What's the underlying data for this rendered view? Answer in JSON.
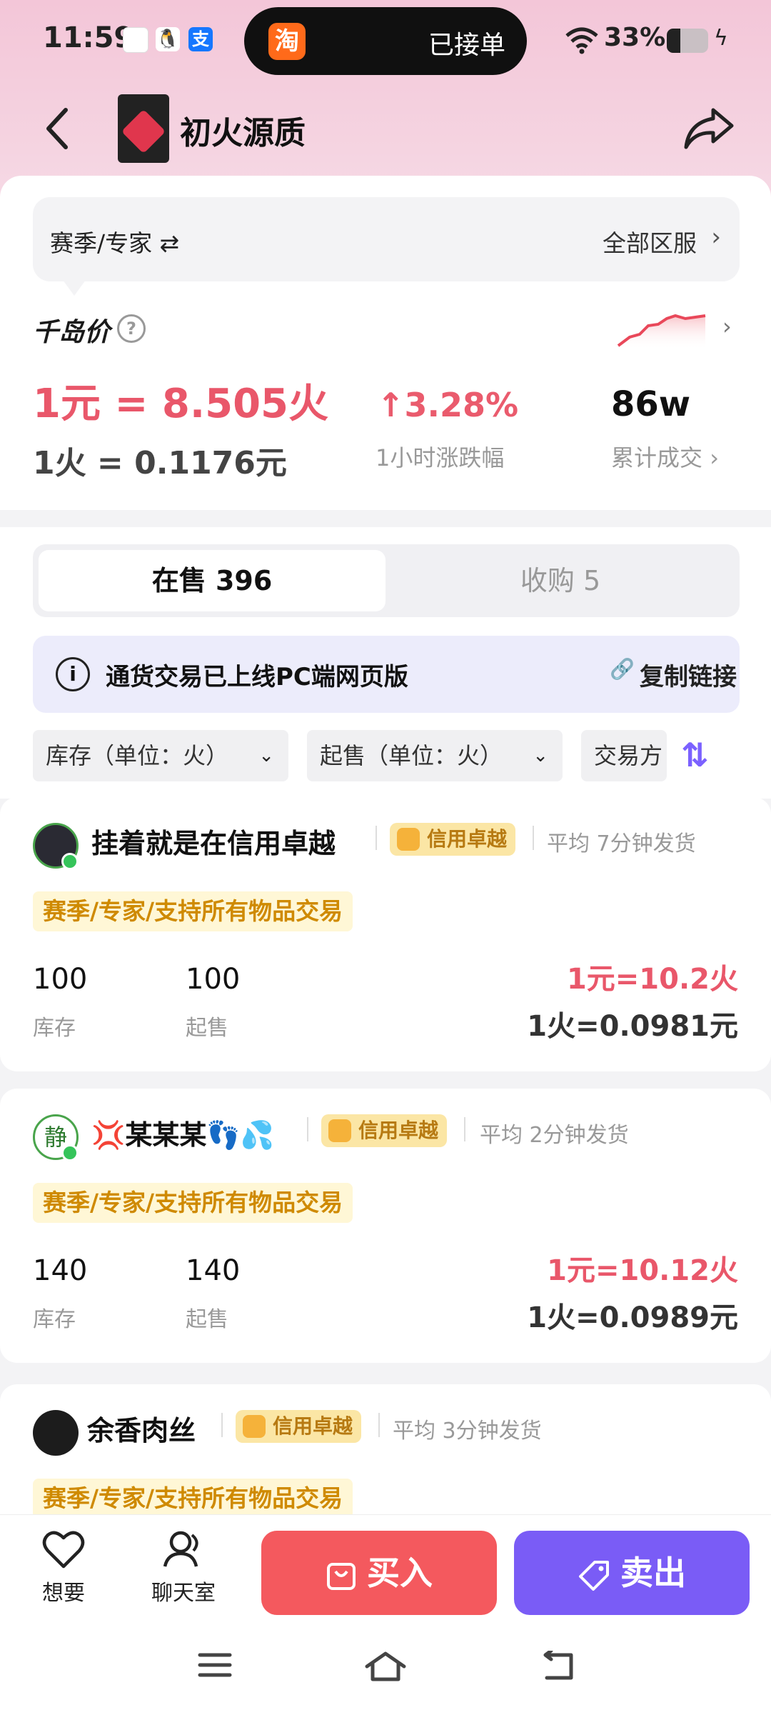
{
  "status": {
    "time": "11:59",
    "pill_text": "已接单",
    "pill_icon_char": "淘",
    "battery": "33%"
  },
  "header": {
    "title": "初火源质"
  },
  "region": {
    "left": "赛季/专家 ⇄",
    "right": "全部区服"
  },
  "price": {
    "brand": "千岛价",
    "rate_yuan": "1元 = 8.505火",
    "rate_fire": "1火 = 0.1176元",
    "change": "3.28%",
    "change_label": "1小时涨跌幅",
    "volume": "86w",
    "volume_label": "累计成交"
  },
  "tabs": {
    "sell": "在售 396",
    "buy": "收购 5"
  },
  "notice": {
    "message": "通货交易已上线PC端网页版",
    "copy": "复制链接"
  },
  "filters": {
    "stock": "库存（单位：火）",
    "min": "起售（单位：火）",
    "trade": "交易方"
  },
  "listings": [
    {
      "name": "挂着就是在信用卓越",
      "badge": "信用卓越",
      "ship": "平均 7分钟发货",
      "tag": "赛季/专家/支持所有物品交易",
      "stock": "100",
      "stock_label": "库存",
      "min": "100",
      "min_label": "起售",
      "rate1": "1元=10.2火",
      "rate2": "1火=0.0981元"
    },
    {
      "name": "💢某某某👣💦",
      "avatar_char": "静",
      "badge": "信用卓越",
      "ship": "平均 2分钟发货",
      "tag": "赛季/专家/支持所有物品交易",
      "stock": "140",
      "stock_label": "库存",
      "min": "140",
      "min_label": "起售",
      "rate1": "1元=10.12火",
      "rate2": "1火=0.0989元"
    },
    {
      "name": "余香肉丝",
      "badge": "信用卓越",
      "ship": "平均 3分钟发货",
      "tag": "赛季/专家/支持所有物品交易"
    }
  ],
  "bottom": {
    "want": "想要",
    "chat": "聊天室",
    "buy": "买入",
    "sell": "卖出"
  },
  "colors": {
    "accent_red": "#f4595e",
    "accent_purple": "#7a5cf6",
    "price_red": "#e9576a"
  }
}
